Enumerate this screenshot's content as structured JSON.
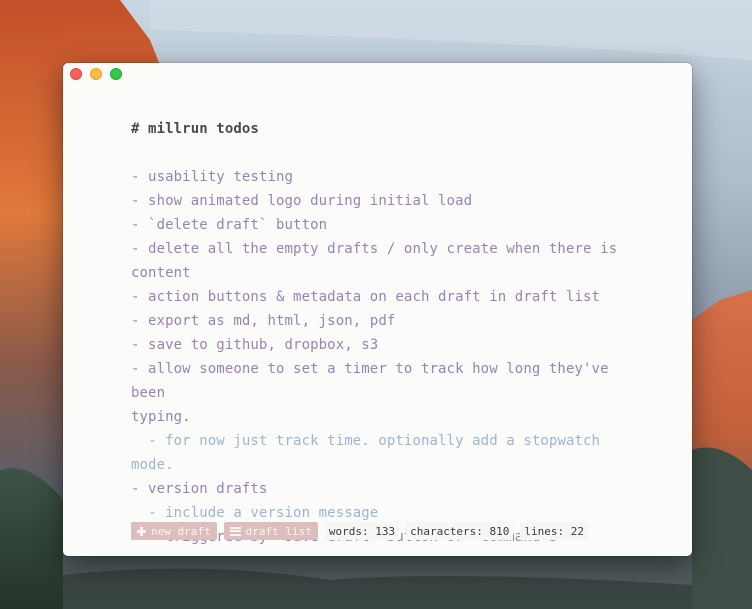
{
  "editor": {
    "lines": [
      {
        "text": "# millrun todos",
        "kind": "heading"
      },
      {
        "text": "",
        "kind": "blank"
      },
      {
        "text": "- usability testing",
        "kind": "item"
      },
      {
        "text": "- show animated logo during initial load",
        "kind": "item"
      },
      {
        "text": "- `delete draft` button",
        "kind": "item"
      },
      {
        "text": "- delete all the empty drafts / only create when there is",
        "kind": "item"
      },
      {
        "text": "content",
        "kind": "item"
      },
      {
        "text": "- action buttons & metadata on each draft in draft list",
        "kind": "item"
      },
      {
        "text": "- export as md, html, json, pdf",
        "kind": "item"
      },
      {
        "text": "- save to github, dropbox, s3",
        "kind": "item"
      },
      {
        "text": "- allow someone to set a timer to track how long they've been",
        "kind": "item"
      },
      {
        "text": "typing.",
        "kind": "item"
      },
      {
        "text": "  - for now just track time. optionally add a stopwatch mode.",
        "kind": "sub"
      },
      {
        "text": "- version drafts",
        "kind": "item"
      },
      {
        "text": "  - include a version message",
        "kind": "sub"
      },
      {
        "text": "  - triggered by `save draft` button or `command+s`",
        "kind": "item"
      }
    ]
  },
  "footer": {
    "new_draft_label": "new draft",
    "draft_list_label": "draft list",
    "words": "words: 133",
    "characters": "characters: 810",
    "lines": "lines: 22"
  },
  "colors": {
    "heading": "#4a4a4a",
    "item": "#9a82b4",
    "sub": "#9bb6d2",
    "button_bg": "#dcbfbc"
  },
  "icons": {
    "new_draft": "plus-icon",
    "draft_list": "list-icon"
  }
}
